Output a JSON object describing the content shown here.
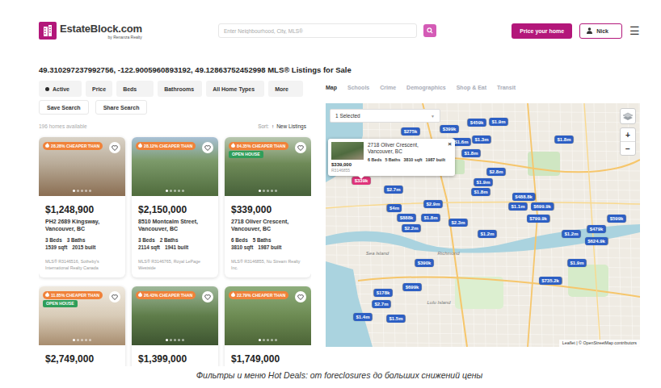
{
  "header": {
    "logo": {
      "name": "EstateBlock.com",
      "tagline": "by Renanza Realty"
    },
    "search": {
      "placeholder": "Enter Neighbourhood, City, MLS®"
    },
    "actions": {
      "price_your_home": "Price your home",
      "user": "Nick",
      "menu": "☰"
    }
  },
  "title": "49.310297237992756, -122.9005960893192, 49.12863752452998 MLS® Listings for Sale",
  "filters": [
    {
      "label": "Active",
      "kind": "status"
    },
    {
      "label": "Price",
      "kind": "dropdown"
    },
    {
      "label": "Beds",
      "kind": "dropdown"
    },
    {
      "label": "Bathrooms",
      "kind": "dropdown"
    },
    {
      "label": "All Home Types",
      "kind": "dropdown"
    },
    {
      "label": "More",
      "kind": "dropdown"
    }
  ],
  "search_actions": [
    "Save Search",
    "Share Search"
  ],
  "results": {
    "count": "196 homes available",
    "sort_label": "Sort:",
    "sort_arrow": "↑",
    "sort_value": "New Listings"
  },
  "listings": [
    {
      "badge": "28.28% CHEAPER THAN",
      "tags": [],
      "favorite": false,
      "price": "$1,248,900",
      "address": "PH2 2689 Kingsway, Vancouver, BC",
      "beds": "3 Beds",
      "baths": "3 Baths",
      "sqft": "1539 sqft",
      "built": "2015 built",
      "mls": "MLS® R3146516, Sotheby's International Realty Canada"
    },
    {
      "badge": "28.12% CHEAPER THAN",
      "tags": [],
      "favorite": false,
      "price": "$2,150,000",
      "address": "8510 Montcalm Street, Vancouver, BC",
      "beds": "3 Beds",
      "baths": "2 Baths",
      "sqft": "2114 sqft",
      "built": "1941 built",
      "mls": "MLS® R3146765, Royal LePage Westside"
    },
    {
      "badge": "84.35% CHEAPER THAN",
      "tags": [
        "OPEN HOUSE"
      ],
      "favorite": false,
      "price": "$339,000",
      "address": "2718 Oliver Crescent, Vancouver, BC",
      "beds": "6 Beds",
      "baths": "5 Baths",
      "sqft": "3810 sqft",
      "built": "1987 built",
      "mls": "MLS® R3146855, Nu Stream Realty Inc."
    },
    {
      "badge": "11.85% CHEAPER THAN",
      "tags": [
        "OPEN HOUSE"
      ],
      "favorite": false,
      "price": "$2,749,000"
    },
    {
      "badge": "26.43% CHEAPER THAN",
      "tags": [],
      "favorite": false,
      "price": "$1,399,000"
    },
    {
      "badge": "22.79% CHEAPER THAN",
      "tags": [],
      "favorite": false,
      "price": "$1,749,000"
    }
  ],
  "view_tabs": [
    {
      "label": "Map",
      "selected": true
    },
    {
      "label": "Schools",
      "selected": false
    },
    {
      "label": "Crime",
      "selected": false
    },
    {
      "label": "Demographics",
      "selected": false
    },
    {
      "label": "Shop & Eat",
      "selected": false
    },
    {
      "label": "Transit",
      "selected": false
    }
  ],
  "map": {
    "dropdown": {
      "label": "1 Selected",
      "caret": "▼"
    },
    "zoom": [
      "+",
      "−"
    ],
    "popup": {
      "address": "2718 Oliver Crescent, Vancouver, BC",
      "close": "×",
      "specs": [
        "6 Beds",
        "5 Baths",
        "3810 sqft",
        "1987 built"
      ],
      "price": "$339,000",
      "mls": "R3146855"
    },
    "place_labels": [
      "Sea Island",
      "Richmond",
      "Lulu Island"
    ],
    "pins": [
      {
        "label": "$275k",
        "selected": false
      },
      {
        "label": "$399k",
        "selected": false
      },
      {
        "label": "$459k",
        "selected": false
      },
      {
        "label": "$1.9m",
        "selected": false
      },
      {
        "label": "$1.6m",
        "selected": false
      },
      {
        "label": "$1.3m",
        "selected": false
      },
      {
        "label": "$1.8m",
        "selected": false
      },
      {
        "label": "$1.8m",
        "selected": false
      },
      {
        "label": "$339k",
        "selected": true
      },
      {
        "label": "$2.7m",
        "selected": false
      },
      {
        "label": "$2.8m",
        "selected": false
      },
      {
        "label": "$1.9m",
        "selected": false
      },
      {
        "label": "$1.8m",
        "selected": false
      },
      {
        "label": "$488.8k",
        "selected": false
      },
      {
        "label": "$1.1m",
        "selected": false
      },
      {
        "label": "$699.9k",
        "selected": false
      },
      {
        "label": "$2.9m",
        "selected": false
      },
      {
        "label": "$4m",
        "selected": false
      },
      {
        "label": "$888k",
        "selected": false
      },
      {
        "label": "$1.8m",
        "selected": false
      },
      {
        "label": "$2.3m",
        "selected": false
      },
      {
        "label": "$799.9k",
        "selected": false
      },
      {
        "label": "$599k",
        "selected": false
      },
      {
        "label": "$479k",
        "selected": false
      },
      {
        "label": "$1.2m",
        "selected": false
      },
      {
        "label": "$624.9k",
        "selected": false
      },
      {
        "label": "$2.2m",
        "selected": false
      },
      {
        "label": "$1.2m",
        "selected": false
      },
      {
        "label": "$390k",
        "selected": false
      },
      {
        "label": "$1.9m",
        "selected": false
      },
      {
        "label": "$735.2k",
        "selected": false
      },
      {
        "label": "$699k",
        "selected": false
      },
      {
        "label": "$178k",
        "selected": false
      },
      {
        "label": "$2.7m",
        "selected": false
      },
      {
        "label": "$1.4m",
        "selected": false
      },
      {
        "label": "$1.5m",
        "selected": false
      }
    ],
    "attribution": "Leaflet | © OpenStreetMap contributors"
  },
  "caption": "Фильтры и меню Hot Deals: от foreclosures до больших снижений цены"
}
